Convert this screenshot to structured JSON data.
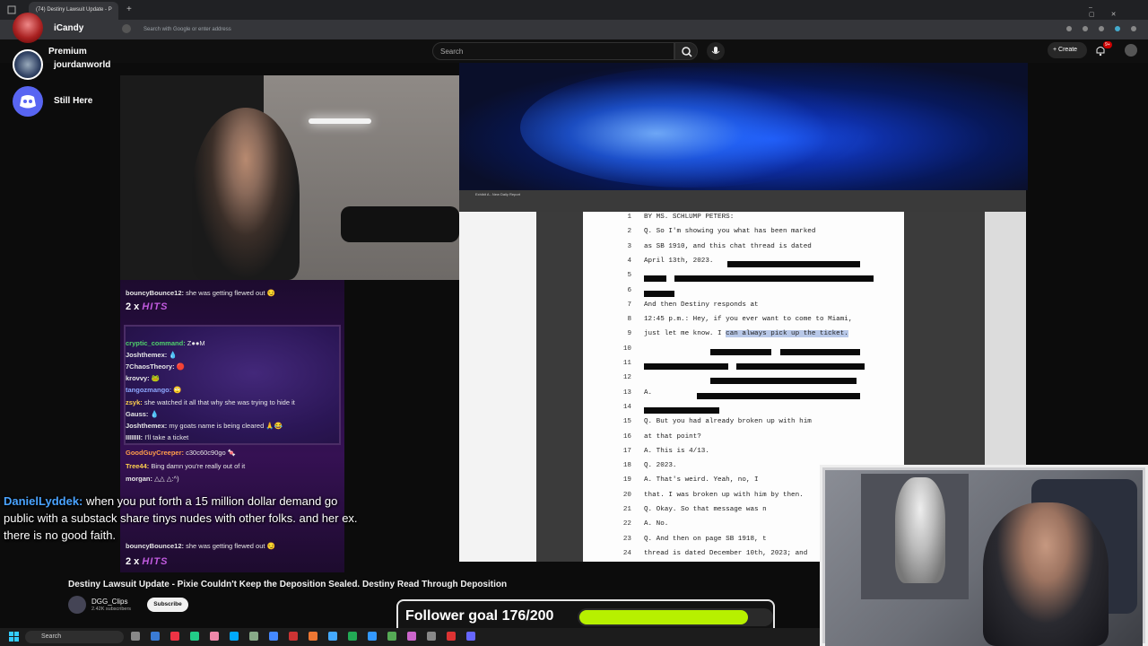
{
  "browser": {
    "tab_title": "(74) Destiny Lawsuit Update - P",
    "address_placeholder": "Search with Google or enter address"
  },
  "youtube": {
    "search_placeholder": "Search",
    "create_label": "Create",
    "notification_badge": "9+"
  },
  "overlay_sidebar": {
    "top_name": "iCandy",
    "premium_label": "Premium",
    "premium_user": "jourdanworld",
    "discord_label": "Still Here"
  },
  "pdf": {
    "tab_label": "Exhibit A - New Daily Report",
    "lines": [
      {
        "n": "1",
        "t": "BY MS. SCHLUMP PETERS:"
      },
      {
        "n": "2",
        "t": "     Q.    So I'm showing you what has been marked"
      },
      {
        "n": "3",
        "t": "as SB 1910, and this chat thread is dated"
      },
      {
        "n": "4",
        "t": "April 13th, 2023."
      },
      {
        "n": "5",
        "t": ""
      },
      {
        "n": "6",
        "t": ""
      },
      {
        "n": "7",
        "t": "           And then Destiny responds at"
      },
      {
        "n": "8",
        "t": "12:45 p.m.:  Hey, if you ever want to come to Miami,"
      },
      {
        "n": "9",
        "t": "just let me know.  I can always pick up the ticket."
      },
      {
        "n": "10",
        "t": ""
      },
      {
        "n": "11",
        "t": ""
      },
      {
        "n": "12",
        "t": ""
      },
      {
        "n": "13",
        "t": "     A."
      },
      {
        "n": "14",
        "t": ""
      },
      {
        "n": "15",
        "t": "     Q.    But you had already broken up with him"
      },
      {
        "n": "16",
        "t": "at that point?"
      },
      {
        "n": "17",
        "t": "     A.    This is 4/13."
      },
      {
        "n": "18",
        "t": "     Q.    2023."
      },
      {
        "n": "19",
        "t": "     A.    That's weird.  Yeah, no, I"
      },
      {
        "n": "20",
        "t": "that.  I was broken up with him by then."
      },
      {
        "n": "21",
        "t": "     Q.    Okay.  So that message was n"
      },
      {
        "n": "22",
        "t": "     A.    No."
      },
      {
        "n": "23",
        "t": "     Q.    And then on page SB 1918, t"
      },
      {
        "n": "24",
        "t": "thread is dated December 10th, 2023; and"
      }
    ],
    "highlight_text": "can always pick up the ticket."
  },
  "chat": {
    "messages": [
      {
        "user": "bouncyBounce12:",
        "text": " she was getting flewed out 😏",
        "color": "#e6e6e6"
      },
      {
        "user": "cryptic_command:",
        "text": " Z●●M",
        "color": "#4fd16b"
      },
      {
        "user": "Joshthemex:",
        "text": " 💧",
        "color": "#e6e6e6"
      },
      {
        "user": "7ChaosTheory:",
        "text": " 🔴",
        "color": "#e6e6e6"
      },
      {
        "user": "krovvy:",
        "text": " 🐸",
        "color": "#e6e6e6"
      },
      {
        "user": "tangozmango:",
        "text": " 🙄",
        "color": "#8ea8ff"
      },
      {
        "user": "zsyk:",
        "text": " she watched it all that why she was trying to hide it",
        "color": "#ffd04d"
      },
      {
        "user": "Gauss:",
        "text": " 💧",
        "color": "#e6e6e6"
      },
      {
        "user": "Joshthemex:",
        "text": " my goats name is being cleared 🙏😂",
        "color": "#e6e6e6"
      },
      {
        "user": "IIIIIIII:",
        "text": " I'll take a ticket",
        "color": "#e6e6e6"
      },
      {
        "user": "GoodGuyCreeper:",
        "text": " c30c60c90go 🍬",
        "color": "#ff9d4a"
      },
      {
        "user": "Tree44:",
        "text": " Bing damn you're really out of it",
        "color": "#ffd04d"
      },
      {
        "user": "morgan:",
        "text": " △△ △:^)",
        "color": "#e6e6e6"
      },
      {
        "user": "bouncyBounce12:",
        "text": " she was getting flewed out 😏",
        "color": "#e6e6e6"
      }
    ],
    "hits_count": "2 x",
    "hits_word": "HITS",
    "featured_user": "DanielLyddek:",
    "featured_text": " when you put forth a 15 million dollar demand go public with a substack share tinys nudes with other folks. and her ex. there is no good faith."
  },
  "video": {
    "title": "Destiny Lawsuit Update - Pixie Couldn't Keep the Deposition Sealed. Destiny Read Through Deposition",
    "channel": "DGG_Clips",
    "subscribers": "2.42K subscribers",
    "subscribe_label": "Subscribe"
  },
  "follower_goal": {
    "label": "Follower goal 176/200",
    "current": 176,
    "target": 200,
    "fill_color": "#b7f000"
  },
  "taskbar": {
    "search_label": "Search"
  }
}
